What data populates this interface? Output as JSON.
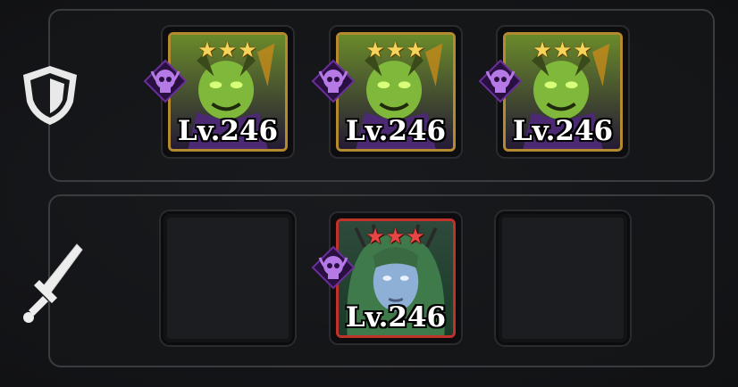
{
  "defense_team": {
    "icon": "shield-icon",
    "slots": [
      {
        "filled": true,
        "hero": "green-demon",
        "faction": "undead-skull-icon",
        "rarity_color": "#b48a2e",
        "stars": "★★★",
        "level": "Lv.246"
      },
      {
        "filled": true,
        "hero": "green-demon",
        "faction": "undead-skull-icon",
        "rarity_color": "#b48a2e",
        "stars": "★★★",
        "level": "Lv.246"
      },
      {
        "filled": true,
        "hero": "green-demon",
        "faction": "undead-skull-icon",
        "rarity_color": "#b48a2e",
        "stars": "★★★",
        "level": "Lv.246"
      }
    ]
  },
  "attack_team": {
    "icon": "sword-icon",
    "slots": [
      {
        "filled": false
      },
      {
        "filled": true,
        "hero": "forest-dryad",
        "faction": "undead-skull-icon",
        "rarity_color": "#c2302a",
        "stars": "★★★",
        "level": "Lv.246"
      },
      {
        "filled": false
      }
    ]
  },
  "colors": {
    "faction_purple": "#8b3fc9",
    "panel_border": "#3a3c40",
    "gold_frame": "#b48a2e",
    "red_frame": "#c2302a"
  }
}
